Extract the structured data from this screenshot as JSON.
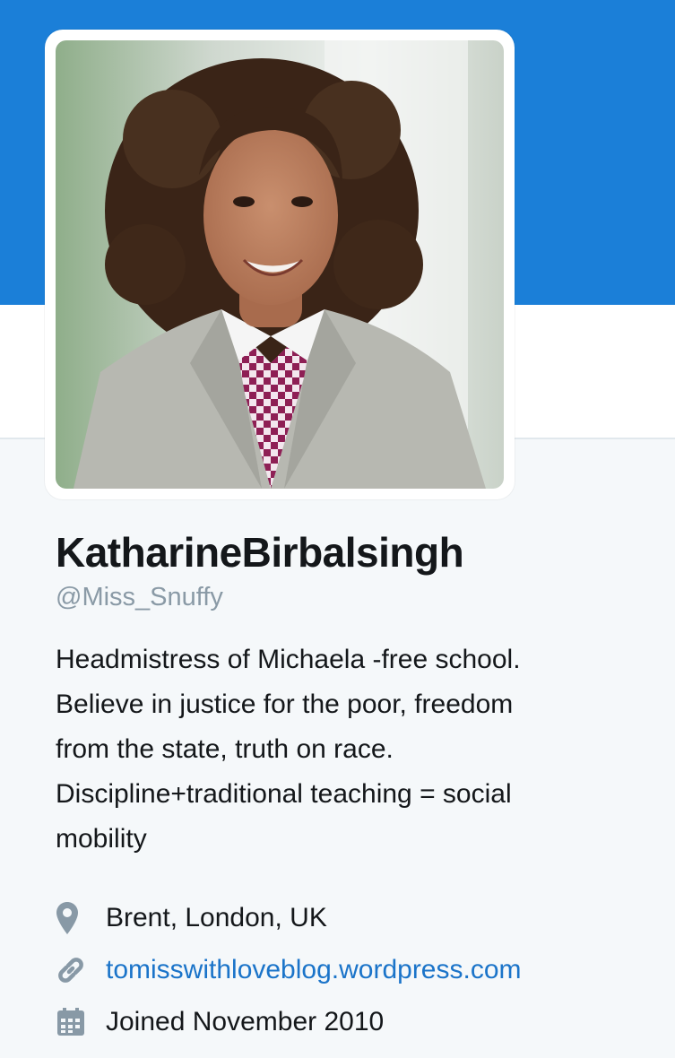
{
  "colors": {
    "banner": "#1b7fd8",
    "link": "#1b74c9",
    "handle": "#8a9aa6",
    "icon": "#8899a6",
    "background": "#f5f8fa"
  },
  "profile": {
    "display_name": "KatharineBirbalsingh",
    "handle": "@Miss_Snuffy",
    "bio_lines": [
      "Headmistress of Michaela -free school.",
      "Believe in justice for the poor, freedom",
      "from the state, truth on race.",
      "Discipline+traditional teaching = social",
      "mobility"
    ],
    "avatar_alt": "profile photo"
  },
  "meta": {
    "location": {
      "icon": "location-pin-icon",
      "text": "Brent, London, UK"
    },
    "website": {
      "icon": "link-icon",
      "text": "tomisswithloveblog.wordpress.com"
    },
    "joined": {
      "icon": "calendar-icon",
      "text": "Joined November 2010"
    }
  }
}
